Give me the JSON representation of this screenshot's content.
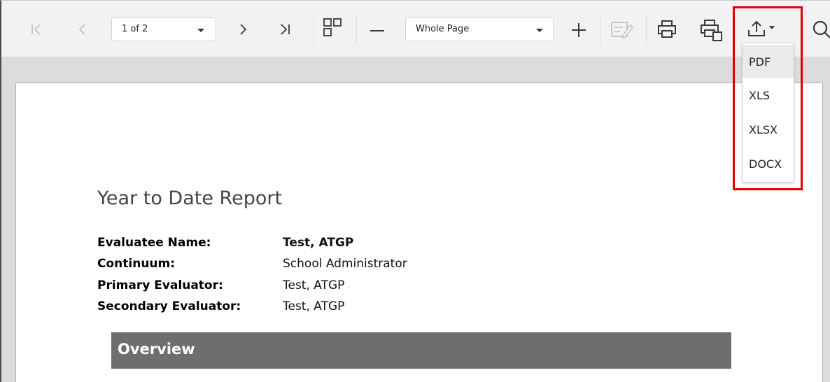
{
  "toolbar": {
    "page_selector": {
      "value": "1 of 2"
    },
    "zoom_selector": {
      "value": "Whole Page"
    },
    "icons": {
      "first": "first-page-icon",
      "prev": "previous-page-icon",
      "next": "next-page-icon",
      "last": "last-page-icon",
      "multipage": "multi-page-view-icon",
      "zoom_out": "zoom-out-icon",
      "zoom_in": "zoom-in-icon",
      "edit": "edit-fields-icon",
      "print": "print-icon",
      "print_page": "print-page-icon",
      "export": "export-icon",
      "search": "search-icon"
    }
  },
  "export_menu": {
    "items": [
      {
        "label": "PDF"
      },
      {
        "label": "XLS"
      },
      {
        "label": "XLSX"
      },
      {
        "label": "DOCX"
      }
    ],
    "highlight_color": "#e00000"
  },
  "report": {
    "title": "Year to Date Report",
    "fields": [
      {
        "label": "Evaluatee Name:",
        "value": "Test, ATGP"
      },
      {
        "label": "Continuum:",
        "value": "School Administrator"
      },
      {
        "label": "Primary Evaluator:",
        "value": "Test, ATGP"
      },
      {
        "label": "Secondary Evaluator:",
        "value": "Test, ATGP"
      }
    ],
    "section_header": "Overview"
  },
  "colors": {
    "toolbar_bg": "#f2f2f2",
    "viewer_bg": "#dcdcdc",
    "section_bg": "#6e6e6e"
  }
}
